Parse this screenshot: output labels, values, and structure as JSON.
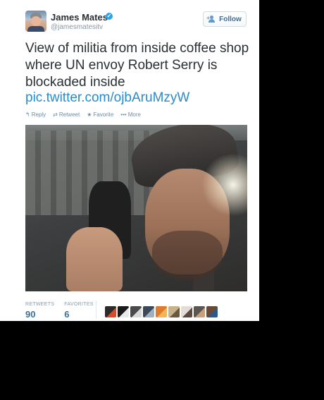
{
  "user": {
    "name": "James Mates",
    "handle": "@jamesmatesitv",
    "verified": true
  },
  "follow_label": "Follow",
  "tweet": {
    "text": "View of militia from inside coffee shop where UN envoy Robert Serry is blockaded inside",
    "link": "pic.twitter.com/ojbAruMzyW"
  },
  "actions": {
    "reply": "Reply",
    "retweet": "Retweet",
    "favorite": "Favorite",
    "more": "More"
  },
  "stats": {
    "retweets_label": "RETWEETS",
    "retweets_value": "90",
    "favorites_label": "FAVORITES",
    "favorites_value": "6"
  },
  "favoriters": [
    {
      "icon": "avatar-1",
      "color": "#2b2b2b",
      "accent": "#d64b2a"
    },
    {
      "icon": "avatar-2",
      "color": "#1a1a1a",
      "accent": "#e8e8e8"
    },
    {
      "icon": "avatar-3",
      "color": "#4a4a4a",
      "accent": "#d9d9d9"
    },
    {
      "icon": "avatar-4",
      "color": "#3b4a5a",
      "accent": "#9fb0bf"
    },
    {
      "icon": "avatar-5",
      "color": "#e27a2c",
      "accent": "#f2b55a"
    },
    {
      "icon": "avatar-6",
      "color": "#c9b18a",
      "accent": "#6b5a40"
    },
    {
      "icon": "avatar-7",
      "color": "#e4ddd6",
      "accent": "#5a4a40"
    },
    {
      "icon": "avatar-8",
      "color": "#5c5650",
      "accent": "#c8a080"
    },
    {
      "icon": "avatar-9",
      "color": "#6b4a35",
      "accent": "#2a5a8a"
    }
  ],
  "colors": {
    "link": "#2b8bc7",
    "verified": "#2aa3ef",
    "text": "#292f33",
    "muted": "#8899a6"
  }
}
